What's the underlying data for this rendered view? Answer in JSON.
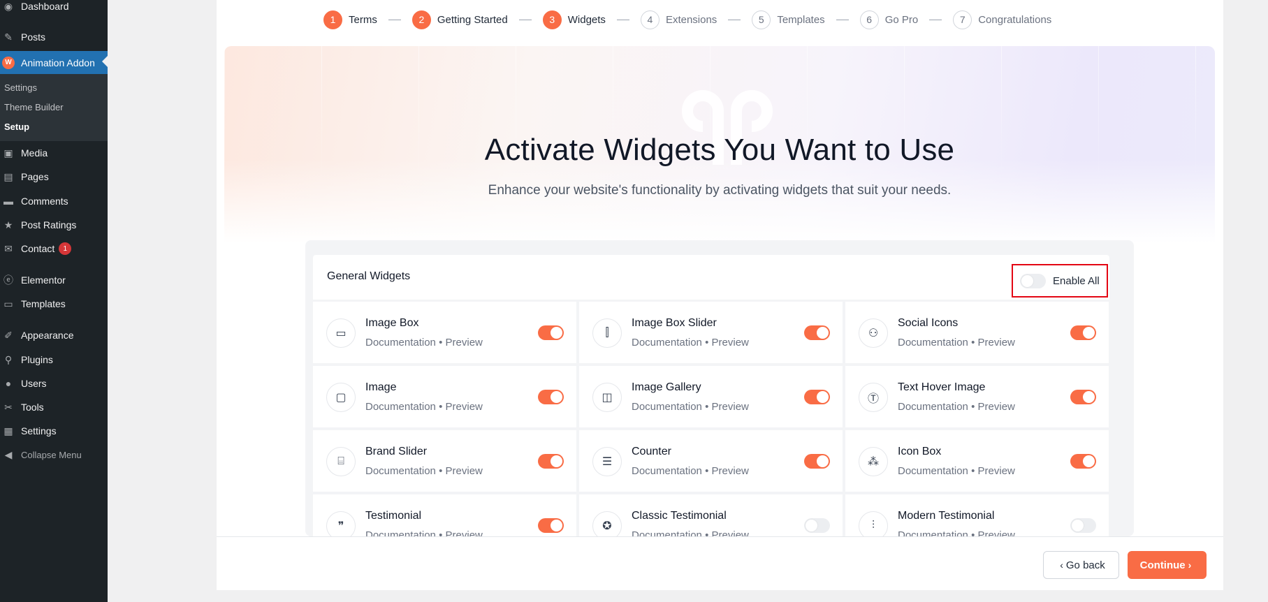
{
  "sidebar": {
    "items": [
      {
        "label": "Dashboard",
        "icon": "dashboard-icon"
      },
      {
        "label": "Posts",
        "icon": "pin-icon"
      },
      {
        "label": "Animation Addon",
        "icon": "animation-addon-logo-icon",
        "active": true
      },
      {
        "label": "Media",
        "icon": "media-icon"
      },
      {
        "label": "Pages",
        "icon": "pages-icon"
      },
      {
        "label": "Comments",
        "icon": "comments-icon"
      },
      {
        "label": "Post Ratings",
        "icon": "star-icon"
      },
      {
        "label": "Contact",
        "icon": "mail-icon",
        "badge": "1"
      },
      {
        "label": "Elementor",
        "icon": "elementor-icon"
      },
      {
        "label": "Templates",
        "icon": "folder-icon"
      },
      {
        "label": "Appearance",
        "icon": "brush-icon"
      },
      {
        "label": "Plugins",
        "icon": "plugin-icon"
      },
      {
        "label": "Users",
        "icon": "user-icon"
      },
      {
        "label": "Tools",
        "icon": "wrench-icon"
      },
      {
        "label": "Settings",
        "icon": "settings-icon"
      }
    ],
    "submenu": [
      "Settings",
      "Theme Builder",
      "Setup"
    ],
    "collapse_label": "Collapse Menu"
  },
  "stepper": {
    "steps": [
      {
        "num": "1",
        "label": "Terms",
        "done": true
      },
      {
        "num": "2",
        "label": "Getting Started",
        "done": true
      },
      {
        "num": "3",
        "label": "Widgets",
        "done": true
      },
      {
        "num": "4",
        "label": "Extensions",
        "done": false
      },
      {
        "num": "5",
        "label": "Templates",
        "done": false
      },
      {
        "num": "6",
        "label": "Go Pro",
        "done": false
      },
      {
        "num": "7",
        "label": "Congratulations",
        "done": false
      }
    ]
  },
  "hero": {
    "title": "Activate Widgets You Want to Use",
    "subtitle": "Enhance your website's functionality by activating widgets that suit your needs."
  },
  "panel": {
    "title": "General Widgets",
    "enable_all_label": "Enable All",
    "enable_all_on": false
  },
  "link_doc": "Documentation",
  "link_sep": "•",
  "link_preview": "Preview",
  "widgets": [
    {
      "name": "Image Box",
      "icon": "image-box-icon",
      "on": true
    },
    {
      "name": "Image Box Slider",
      "icon": "slider-icon",
      "on": true
    },
    {
      "name": "Social Icons",
      "icon": "social-icon",
      "on": true
    },
    {
      "name": "Image",
      "icon": "image-icon",
      "on": true
    },
    {
      "name": "Image Gallery",
      "icon": "gallery-icon",
      "on": true
    },
    {
      "name": "Text Hover Image",
      "icon": "text-icon",
      "on": true
    },
    {
      "name": "Brand Slider",
      "icon": "brand-icon",
      "on": true
    },
    {
      "name": "Counter",
      "icon": "counter-icon",
      "on": true
    },
    {
      "name": "Icon Box",
      "icon": "shapes-icon",
      "on": true
    },
    {
      "name": "Testimonial",
      "icon": "quote-icon",
      "on": true
    },
    {
      "name": "Classic Testimonial",
      "icon": "badge-star-icon",
      "on": false
    },
    {
      "name": "Modern Testimonial",
      "icon": "align-icon",
      "on": false
    }
  ],
  "footer": {
    "back_label": "Go back",
    "continue_label": "Continue"
  },
  "colors": {
    "accent": "#f96c45",
    "sidebar_bg": "#1d2327",
    "active_menu": "#2271b1",
    "highlight_box": "#e30613"
  }
}
